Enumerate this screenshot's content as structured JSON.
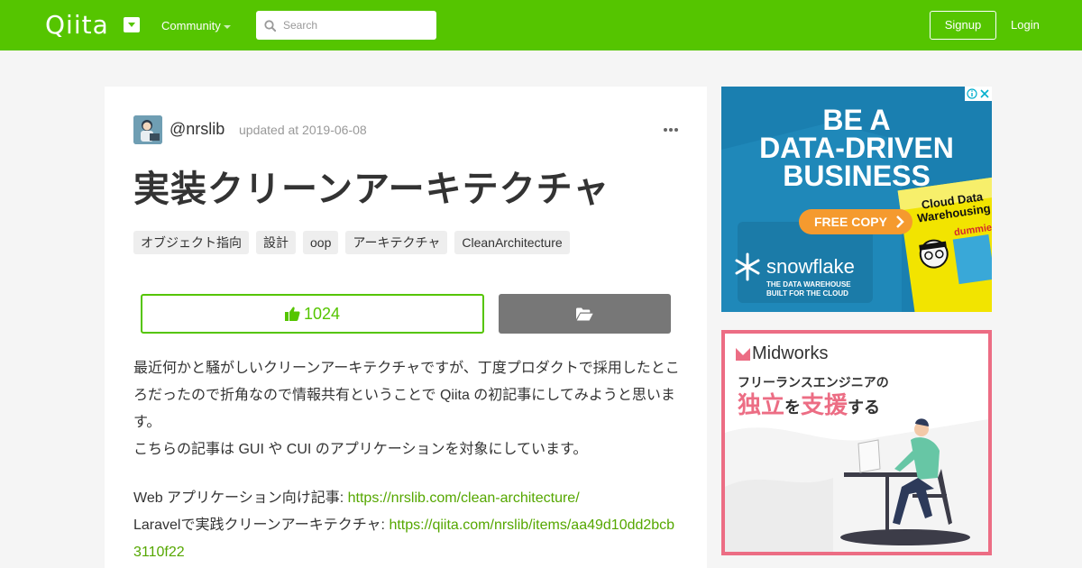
{
  "header": {
    "logo": "Qiita",
    "community_label": "Community",
    "search_placeholder": "Search",
    "signup_label": "Signup",
    "login_label": "Login",
    "brand_color": "#55c500"
  },
  "article": {
    "author": "@nrslib",
    "updated": "updated at 2019-06-08",
    "title": "実装クリーンアーキテクチャ",
    "tags": [
      "オブジェクト指向",
      "設計",
      "oop",
      "アーキテクチャ",
      "CleanArchitecture"
    ],
    "likes": "1024",
    "paragraph1": "最近何かと騒がしいクリーンアーキテクチャですが、丁度プロダクトで採用したところだったので折角なので情報共有ということで Qiita の初記事にしてみようと思います。",
    "paragraph2": "こちらの記事は GUI や CUI のアプリケーションを対象にしています。",
    "link1_label": "Web アプリケーション向け記事: ",
    "link1_url": "https://nrslib.com/clean-architecture/",
    "link2_label": "Laravelで実践クリーンアーキテクチャ: ",
    "link2_url": "https://qiita.com/nrslib/items/aa49d10dd2bcb3110f22"
  },
  "ad1": {
    "headline1": "BE A",
    "headline2": "DATA-DRIVEN",
    "headline3": "BUSINESS",
    "cta": "FREE COPY",
    "brand": "snowflake",
    "tagline1": "THE DATA WAREHOUSE",
    "tagline2": "BUILT FOR THE CLOUD",
    "book_title1": "Cloud Data",
    "book_title2": "Warehousing",
    "book_series": "dummies"
  },
  "ad2": {
    "brand": "Midworks",
    "line1": "フリーランスエンジニアの",
    "word1": "独立",
    "particle1": "を",
    "word2": "支援",
    "particle2": "する",
    "border_color": "#ec6d84"
  }
}
